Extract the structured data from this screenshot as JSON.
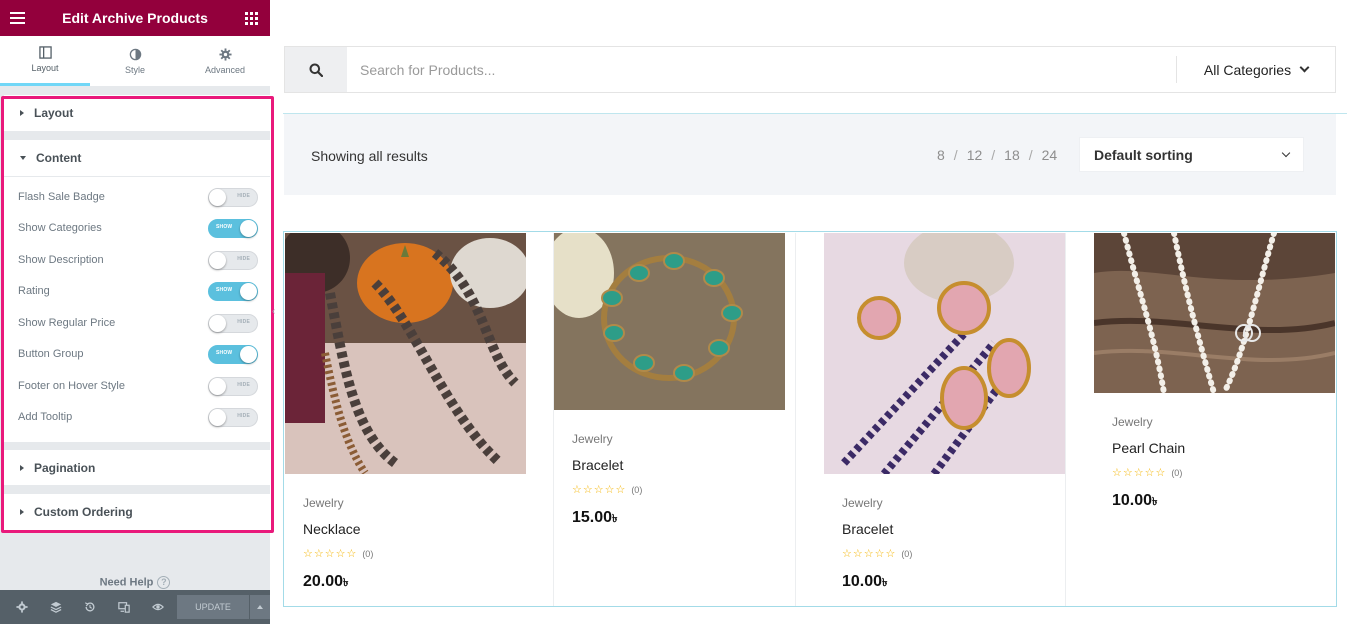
{
  "sidebar": {
    "title": "Edit Archive Products",
    "tabs": [
      {
        "label": "Layout",
        "icon": "layout-icon"
      },
      {
        "label": "Style",
        "icon": "contrast-icon"
      },
      {
        "label": "Advanced",
        "icon": "gear-icon"
      }
    ],
    "sections": {
      "layout": "Layout",
      "content": "Content",
      "pagination": "Pagination",
      "custom_ordering": "Custom Ordering"
    },
    "controls": [
      {
        "label": "Flash Sale Badge",
        "state": "HIDE"
      },
      {
        "label": "Show Categories",
        "state": "SHOW"
      },
      {
        "label": "Show Description",
        "state": "HIDE"
      },
      {
        "label": "Rating",
        "state": "SHOW"
      },
      {
        "label": "Show Regular Price",
        "state": "HIDE"
      },
      {
        "label": "Button Group",
        "state": "SHOW"
      },
      {
        "label": "Footer on Hover Style",
        "state": "HIDE"
      },
      {
        "label": "Add Tooltip",
        "state": "HIDE"
      }
    ],
    "need_help": "Need Help",
    "update_label": "UPDATE",
    "accent_color": "#93003c",
    "highlight_color": "#e9197b"
  },
  "search": {
    "placeholder": "Search for Products...",
    "category": "All Categories"
  },
  "toolbar": {
    "results": "Showing all results",
    "per_page": [
      "8",
      "12",
      "18",
      "24"
    ],
    "sort": "Default sorting"
  },
  "products": [
    {
      "category": "Jewelry",
      "name": "Necklace",
      "stars": "☆☆☆☆☆",
      "reviews": "(0)",
      "price": "20.00",
      "currency": "৳"
    },
    {
      "category": "Jewelry",
      "name": "Bracelet",
      "stars": "☆☆☆☆☆",
      "reviews": "(0)",
      "price": "15.00",
      "currency": "৳"
    },
    {
      "category": "Jewelry",
      "name": "Bracelet",
      "stars": "☆☆☆☆☆",
      "reviews": "(0)",
      "price": "10.00",
      "currency": "৳"
    },
    {
      "category": "Jewelry",
      "name": "Pearl Chain",
      "stars": "☆☆☆☆☆",
      "reviews": "(0)",
      "price": "10.00",
      "currency": "৳"
    }
  ]
}
